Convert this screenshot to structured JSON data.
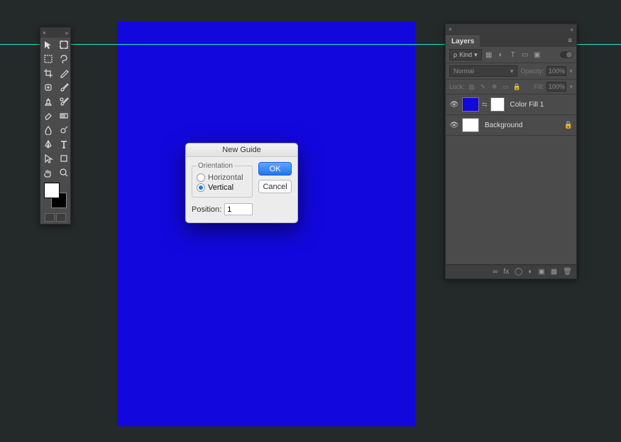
{
  "canvas": {
    "color": "#1208dd"
  },
  "tools": {
    "header_close": "×",
    "header_expand": "»"
  },
  "dialog": {
    "title": "New Guide",
    "orientation_legend": "Orientation",
    "horizontal_label": "Horizontal",
    "vertical_label": "Vertical",
    "selected": "vertical",
    "position_label": "Position:",
    "position_value": "1",
    "ok_label": "OK",
    "cancel_label": "Cancel"
  },
  "layers": {
    "header_close": "×",
    "header_collapse": "«",
    "tab_label": "Layers",
    "menu_glyph": "≡",
    "kind_label": "Kind",
    "blend_mode": "Normal",
    "opacity_label": "Opacity:",
    "opacity_value": "100%",
    "lock_label": "Lock:",
    "fill_label": "Fill:",
    "fill_value": "100%",
    "items": [
      {
        "name": "Color Fill 1",
        "visible": true,
        "thumb": "blue",
        "has_mask": true,
        "locked": false
      },
      {
        "name": "Background",
        "visible": true,
        "thumb": "white",
        "has_mask": false,
        "locked": true
      }
    ],
    "footer": {
      "link": "∞",
      "fx": "fx",
      "mask": "◯",
      "adj": "◐",
      "group": "▣",
      "new": "▦",
      "trash": "🗑"
    }
  }
}
